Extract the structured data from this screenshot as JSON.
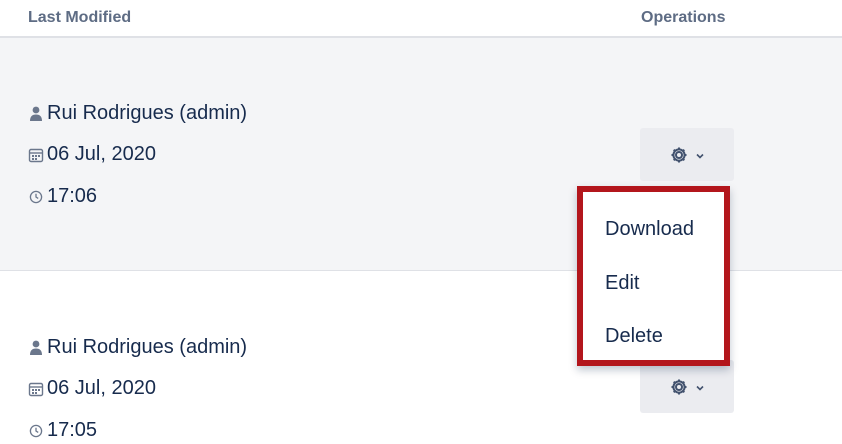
{
  "table": {
    "headers": {
      "last_modified": "Last Modified",
      "operations": "Operations"
    },
    "rows": [
      {
        "user": "Rui Rodrigues (admin)",
        "date": "06 Jul, 2020",
        "time": "17:06"
      },
      {
        "user": "Rui Rodrigues (admin)",
        "date": "06 Jul, 2020",
        "time": "17:05"
      }
    ]
  },
  "dropdown": {
    "items": [
      "Download",
      "Edit",
      "Delete"
    ],
    "highlight_color": "#b3161c"
  },
  "icons": {
    "user": "user-icon",
    "date": "calendar-icon",
    "time": "clock-icon",
    "operations": "gear-icon",
    "dropdown": "chevron-down-icon"
  },
  "colors": {
    "header_text": "#5e6c84",
    "body_text": "#172b4d",
    "row_highlight": "#f4f5f7",
    "button_bg": "#ebecf0"
  }
}
